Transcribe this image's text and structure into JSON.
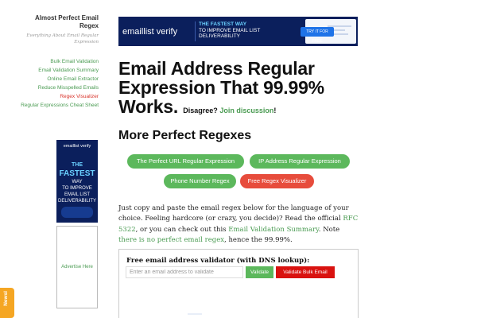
{
  "site": {
    "title": "Almost Perfect Email Regex",
    "tagline": "Everything About Email Regular Expression"
  },
  "sidebar": {
    "items": [
      {
        "label": "Bulk Email Validation",
        "active": false
      },
      {
        "label": "Email Validation Summary",
        "active": false
      },
      {
        "label": "Online Email Extractor",
        "active": false
      },
      {
        "label": "Reduce Misspelled Emails",
        "active": false
      },
      {
        "label": "Regex Visualizer",
        "active": true
      },
      {
        "label": "Regular Expressions Cheat Sheet",
        "active": false
      }
    ],
    "ad": {
      "brand": "emaillist verify",
      "lines": [
        "THE",
        "FASTEST",
        "WAY",
        "TO IMPROVE",
        "EMAIL LIST",
        "DELIVERABILITY"
      ]
    },
    "advertise_label": "Advertise Here",
    "newsletter_label": "Newsl"
  },
  "banner": {
    "brand": "emaillist verify",
    "tagline_highlight": "THE FASTEST WAY",
    "tagline_rest": "TO IMPROVE EMAIL LIST DELIVERABILITY",
    "cta": "TRY IT FOR FREE"
  },
  "main": {
    "title": "Email Address Regular Expression That 99.99% Works.",
    "disagree_prefix": "Disagree?",
    "join_link": "Join discussion",
    "disagree_suffix": "!",
    "section_title": "More Perfect Regexes",
    "regex_links": [
      {
        "label": "The Perfect URL Regular Expression",
        "color": "#5cb85c"
      },
      {
        "label": "IP Address Regular Expression",
        "color": "#5cb85c"
      },
      {
        "label": "Phone Number Regex",
        "color": "#5cb85c"
      },
      {
        "label": "Free Regex Visualizer",
        "color": "#e74c3c"
      }
    ],
    "paragraph": {
      "t1": "Just copy and paste the email regex below for the language of your choice. Feeling hardcore (or crazy, you decide)? Read the official ",
      "rfc_link": "RFC 5322",
      "t2": ", or you can check out this ",
      "summary_link": "Email Validation Summary",
      "t3": ". Note ",
      "no_perfect_link": "there is no perfect email regex",
      "t4": ", hence the 99.99%."
    }
  },
  "validator": {
    "title": "Free email address validator (with DNS lookup):",
    "placeholder": "Enter an email address to validate",
    "value": "",
    "validate_label": "Validate",
    "bulk_label": "Validate Bulk Email"
  },
  "colors": {
    "accent_green": "#4a9b52",
    "accent_red": "#d9342b",
    "ad_navy": "#0b1f5c",
    "newsletter_orange": "#f5a623"
  }
}
